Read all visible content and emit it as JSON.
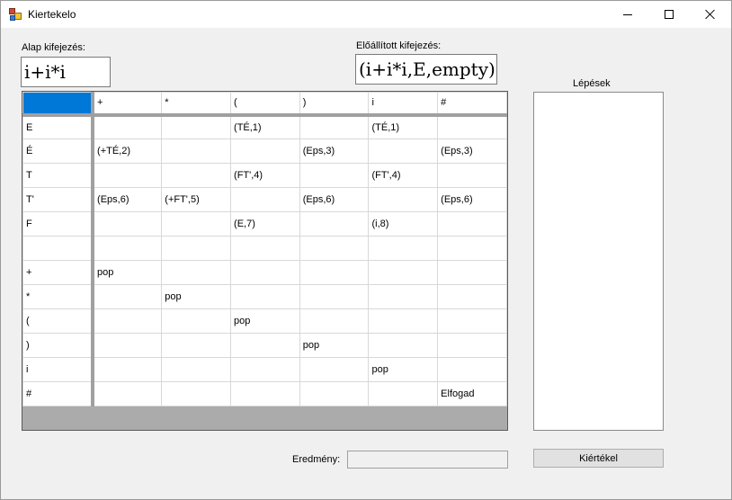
{
  "window": {
    "title": "Kiertekelo",
    "icon": "application-icon"
  },
  "base_expression": {
    "label": "Alap kifejezés:",
    "value": "i+i*i"
  },
  "generated_expression": {
    "label": "Előállított kifejezés:",
    "value": "(i+i*i,E,empty)"
  },
  "table": {
    "columns": [
      "",
      "+",
      "*",
      "(",
      ")",
      "i",
      "#"
    ],
    "rows": [
      {
        "head": "E",
        "cells": [
          "",
          "",
          "(TÉ,1)",
          "",
          "(TÉ,1)",
          ""
        ]
      },
      {
        "head": "É",
        "cells": [
          "(+TÉ,2)",
          "",
          "",
          "(Eps,3)",
          "",
          "(Eps,3)"
        ]
      },
      {
        "head": "T",
        "cells": [
          "",
          "",
          "(FT',4)",
          "",
          "(FT',4)",
          ""
        ]
      },
      {
        "head": "T'",
        "cells": [
          "(Eps,6)",
          "(+FT',5)",
          "",
          "(Eps,6)",
          "",
          "(Eps,6)"
        ]
      },
      {
        "head": "F",
        "cells": [
          "",
          "",
          "(E,7)",
          "",
          "(i,8)",
          ""
        ]
      },
      {
        "head": "",
        "cells": [
          "",
          "",
          "",
          "",
          "",
          ""
        ]
      },
      {
        "head": "+",
        "cells": [
          "pop",
          "",
          "",
          "",
          "",
          ""
        ]
      },
      {
        "head": "*",
        "cells": [
          "",
          "pop",
          "",
          "",
          "",
          ""
        ]
      },
      {
        "head": "(",
        "cells": [
          "",
          "",
          "pop",
          "",
          "",
          ""
        ]
      },
      {
        "head": ")",
        "cells": [
          "",
          "",
          "",
          "pop",
          "",
          ""
        ]
      },
      {
        "head": "i",
        "cells": [
          "",
          "",
          "",
          "",
          "pop",
          ""
        ]
      },
      {
        "head": "#",
        "cells": [
          "",
          "",
          "",
          "",
          "",
          "Elfogad"
        ]
      }
    ]
  },
  "steps": {
    "label": "Lépések"
  },
  "result": {
    "label": "Eredmény:",
    "value": ""
  },
  "evaluate_button": {
    "label": "Kiértékel"
  },
  "colors": {
    "selection": "#0078d7",
    "grid_background": "#ababab",
    "window_background": "#f0f0f0"
  }
}
